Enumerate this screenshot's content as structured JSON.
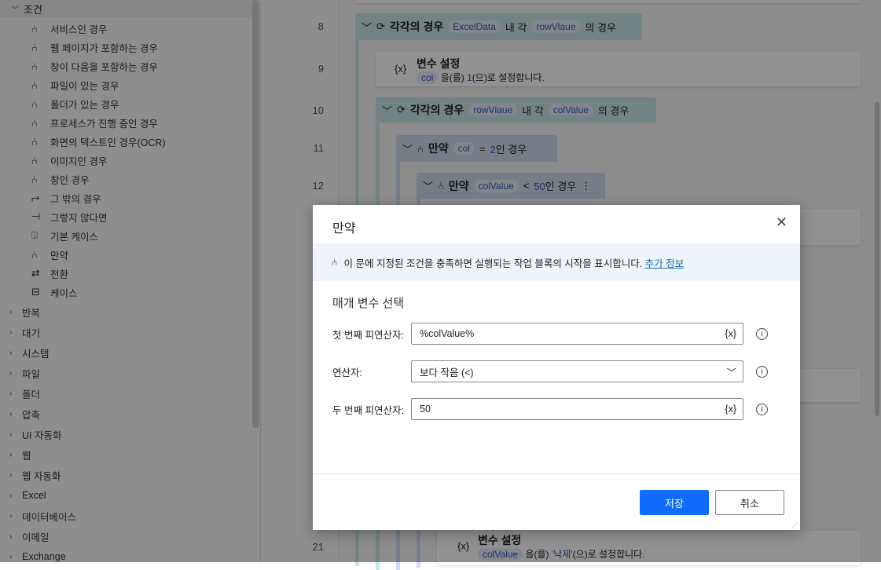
{
  "sidebar": {
    "group": "조건",
    "items": [
      {
        "label": "서비스인 경우",
        "icon": "branch-icon"
      },
      {
        "label": "웹 페이지가 포함하는 경우",
        "icon": "branch-icon"
      },
      {
        "label": "창이 다음을 포함하는 경우",
        "icon": "branch-icon"
      },
      {
        "label": "파일이 있는 경우",
        "icon": "branch-icon"
      },
      {
        "label": "폴더가 있는 경우",
        "icon": "branch-icon"
      },
      {
        "label": "프로세스가 진행 중인 경우",
        "icon": "branch-icon"
      },
      {
        "label": "화면의 텍스트인 경우(OCR)",
        "icon": "branch-icon"
      },
      {
        "label": "이미지인 경우",
        "icon": "branch-icon"
      },
      {
        "label": "창인 경우",
        "icon": "branch-icon"
      },
      {
        "label": "그 밖의 경우",
        "icon": "else-if-icon"
      },
      {
        "label": "그렇지 않다면",
        "icon": "else-icon"
      },
      {
        "label": "기본 케이스",
        "icon": "default-case-icon"
      },
      {
        "label": "만약",
        "icon": "branch-icon"
      },
      {
        "label": "전환",
        "icon": "switch-icon"
      },
      {
        "label": "케이스",
        "icon": "case-icon"
      }
    ],
    "categories": [
      "반복",
      "대기",
      "시스템",
      "파일",
      "폴더",
      "압축",
      "UI 자동화",
      "웹",
      "웹 자동화",
      "Excel",
      "데이터베이스",
      "이메일",
      "Exchange"
    ]
  },
  "flow": {
    "line_numbers": [
      "8",
      "9",
      "10",
      "11",
      "12",
      "21"
    ],
    "row8": {
      "title": "각각의 경우",
      "a": "ExcelData",
      "mid": "내 각",
      "b": "rowVlaue",
      "end": "의 경우"
    },
    "row9": {
      "title": "변수 설정",
      "var": "col",
      "t1": "을(를)",
      "val": "1",
      "t2": "(으)로 설정합니다."
    },
    "row10": {
      "title": "각각의 경우",
      "a": "rowVlaue",
      "mid": "내 각",
      "b": "colValue",
      "end": "의 경우"
    },
    "row11": {
      "title": "만약",
      "var": "col",
      "op": "=",
      "val": "2",
      "end": "인 경우"
    },
    "row12": {
      "title": "만약",
      "var": "colValue",
      "op": "<",
      "val": "50",
      "end": "인 경우"
    },
    "row21": {
      "title": "변수 설정",
      "var": "colValue",
      "t1": "을(를)",
      "val": "'낙제'",
      "t2": "(으)로 설정합니다."
    }
  },
  "dialog": {
    "title": "만약",
    "info": "이 문에 지정된 조건을 충족하면 실행되는 작업 블록의 시작을 표시합니다.",
    "info_link": "추가 정보",
    "section": "매개 변수 선택",
    "first_label": "첫 번째 피연산자:",
    "first_value": "%colValue%",
    "operator_label": "연산자:",
    "operator_value": "보다 작음 (<)",
    "second_label": "두 번째 피연산자:",
    "second_value": "50",
    "var_icon": "{x}",
    "save": "저장",
    "cancel": "취소"
  }
}
